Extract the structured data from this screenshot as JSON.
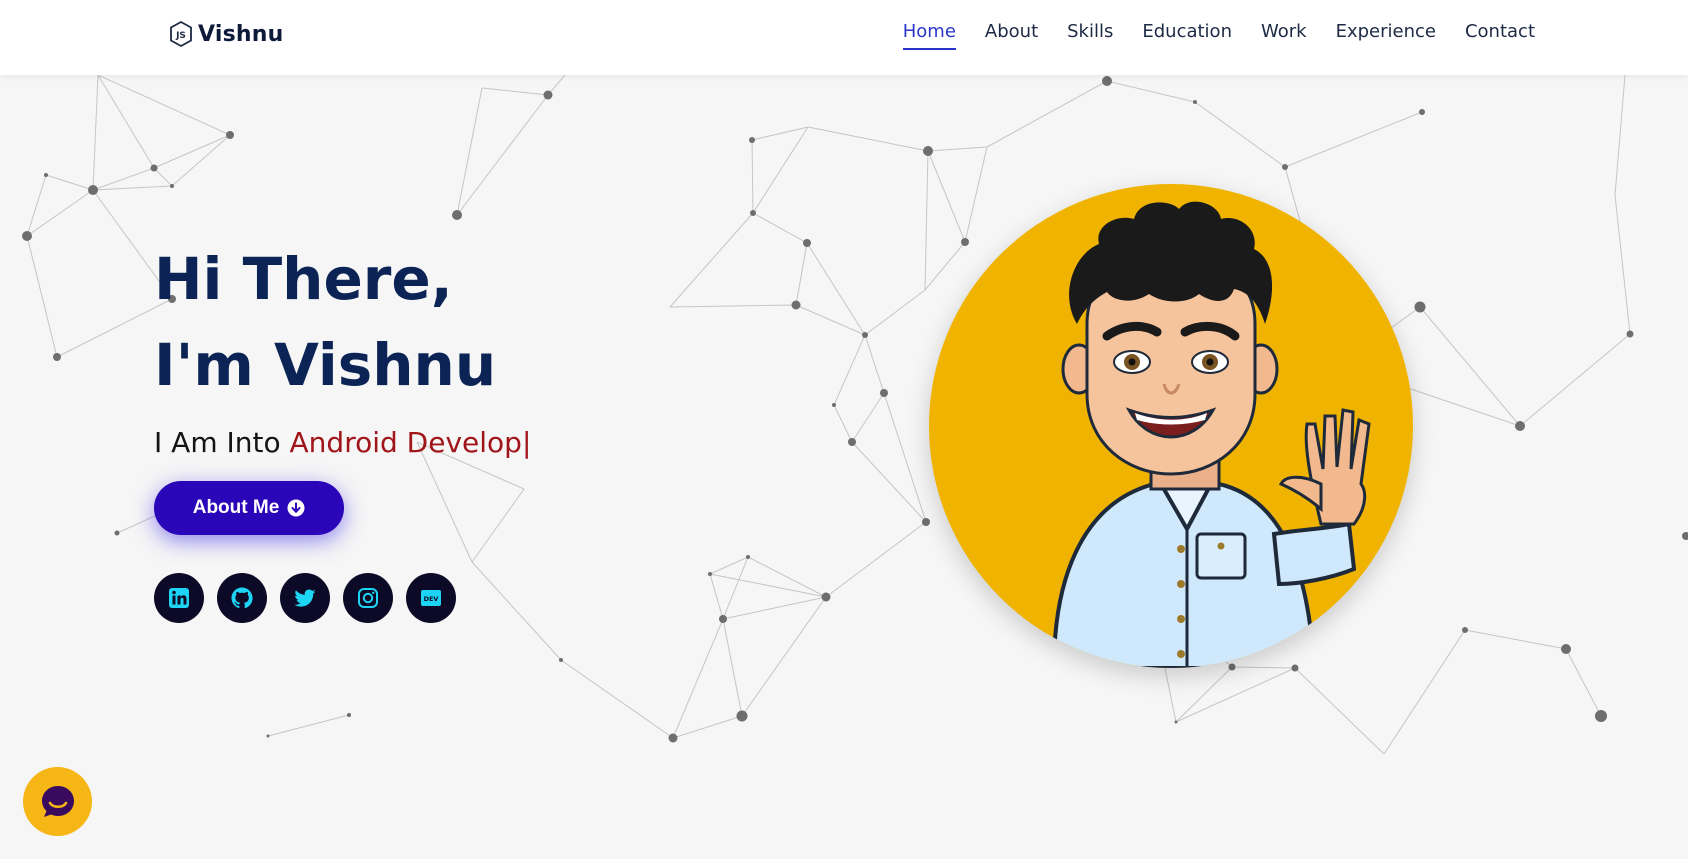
{
  "brand": {
    "name": "Vishnu",
    "icon": "nodejs-hexagon-icon"
  },
  "nav": [
    {
      "label": "Home",
      "active": true
    },
    {
      "label": "About",
      "active": false
    },
    {
      "label": "Skills",
      "active": false
    },
    {
      "label": "Education",
      "active": false
    },
    {
      "label": "Work",
      "active": false
    },
    {
      "label": "Experience",
      "active": false
    },
    {
      "label": "Contact",
      "active": false
    }
  ],
  "hero": {
    "greeting": "Hi There,",
    "intro": "I'm Vishnu",
    "tagline_prefix": "I Am Into",
    "typed_text": "Android Develop",
    "cursor": "|",
    "button_label": "About Me",
    "button_icon": "arrow-circle-down-icon"
  },
  "socials": [
    {
      "name": "linkedin-icon"
    },
    {
      "name": "github-icon"
    },
    {
      "name": "twitter-icon"
    },
    {
      "name": "instagram-icon"
    },
    {
      "name": "dev-icon",
      "text": "DEV"
    }
  ],
  "avatar": {
    "icon": "waving-cartoon-avatar"
  },
  "chat": {
    "icon": "chat-bubble-icon"
  },
  "colors": {
    "accent": "#2a36c9",
    "button": "#2b06b8",
    "heading": "#0b2455",
    "typed": "#a0151a",
    "avatar_bg": "#f0b400",
    "social_bg": "#0c0a26",
    "social_icon": "#1ed4f5",
    "chat_bg": "#f6b716"
  }
}
